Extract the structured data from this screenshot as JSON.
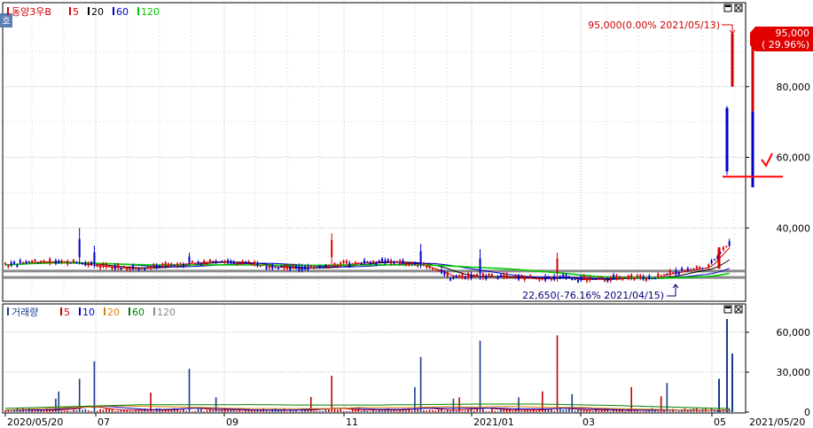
{
  "chart_data": [
    {
      "type": "candlestick",
      "legend": {
        "stock_name": "동양3우B",
        "ma_labels": [
          "5",
          "20",
          "60",
          "120"
        ],
        "ma_colors": [
          "#d40000",
          "#000000",
          "#0000cc",
          "#00cc00"
        ]
      },
      "y_ticks": [
        40000,
        60000,
        80000
      ],
      "y_tick_labels": [
        "40,000",
        "60,000",
        "80,000"
      ],
      "ylim": [
        22000,
        97000
      ],
      "last_price": {
        "label": "95,000",
        "change": "( 29.96%)",
        "value": 95000
      },
      "annotation_high": {
        "text": "95,000(0.00% 2021/05/13)",
        "value": 95000
      },
      "annotation_low": {
        "text": "22,650(-76.16% 2021/04/15)",
        "value": 22650
      },
      "support_lines": [
        26000,
        27800
      ],
      "reference_line": 54500
    },
    {
      "type": "bar",
      "legend": {
        "label": "거래량",
        "ma_labels": [
          "5",
          "10",
          "20",
          "60",
          "120"
        ],
        "ma_colors": [
          "#d40000",
          "#0000cc",
          "#e08000",
          "#008000",
          "#888888"
        ]
      },
      "y_ticks": [
        0,
        30000,
        60000
      ],
      "y_tick_labels": [
        "0",
        "30,000",
        "60,000"
      ],
      "ylim": [
        0,
        75000
      ]
    }
  ],
  "x_axis": {
    "labels": [
      "2020/05/20",
      "07",
      "09",
      "11",
      "2021/01",
      "03",
      "05"
    ],
    "end_label": "2021/05/20"
  },
  "corner_badge": "호"
}
